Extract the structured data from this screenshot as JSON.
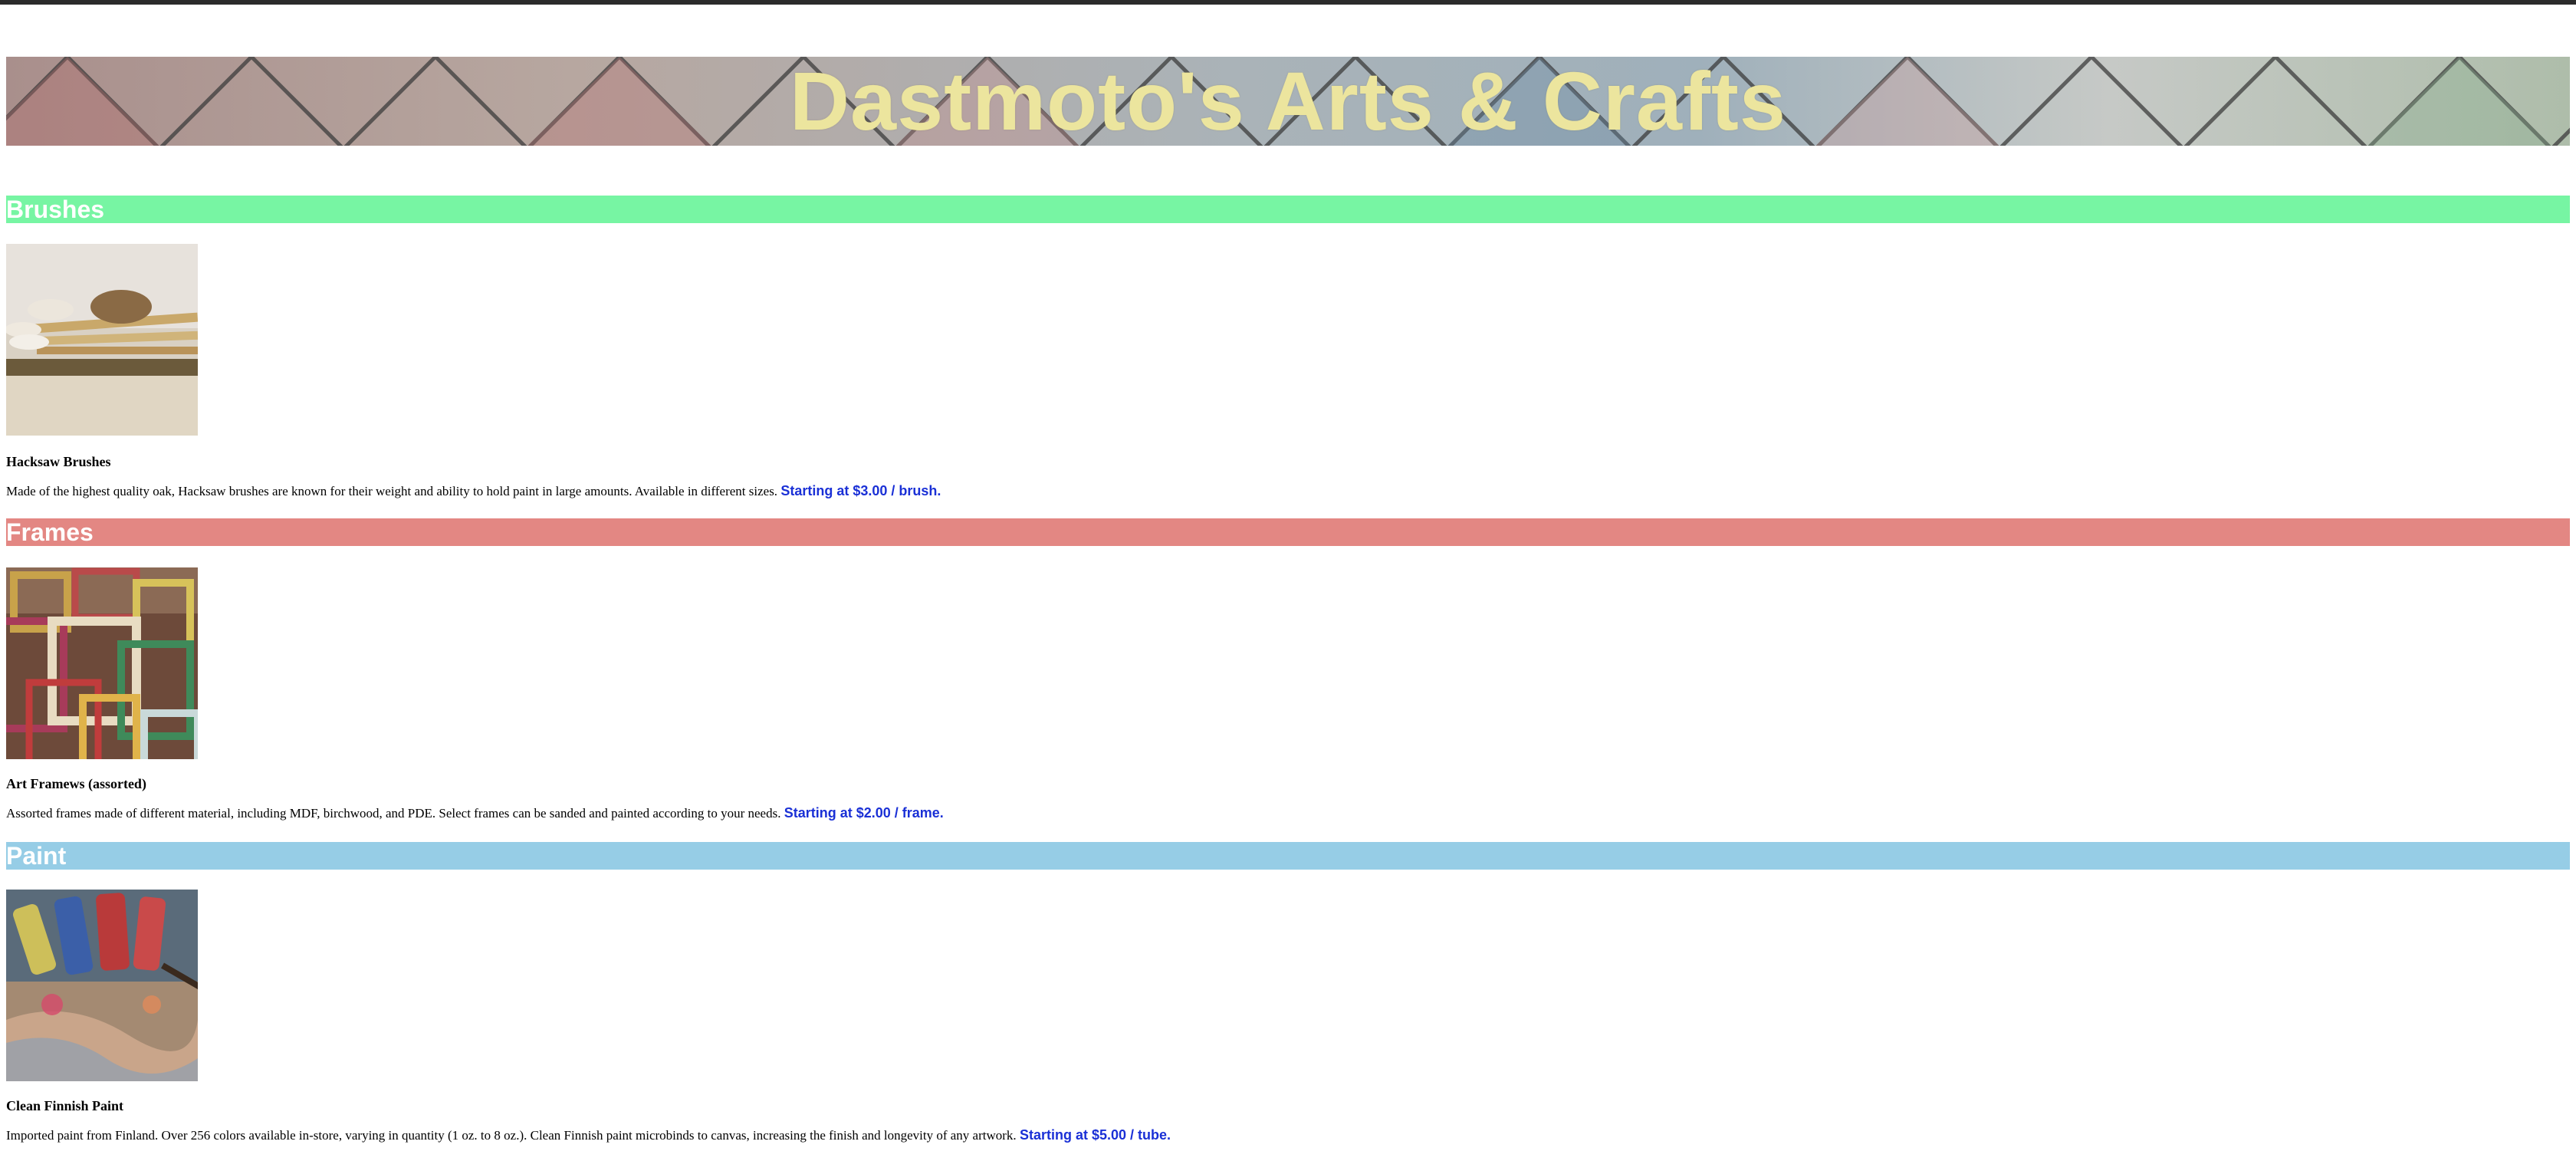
{
  "site_title": "Dastmoto's Arts & Crafts",
  "colors": {
    "title": "#ece59e",
    "brushes_header": "#77f5a3",
    "frames_header": "#e38783",
    "paint_header": "#96cde6",
    "price": "#1a30d6"
  },
  "sections": [
    {
      "heading": "Brushes",
      "image_icon": "brushes-photo",
      "product_name": "Hacksaw Brushes",
      "description": "Made of the highest quality oak, Hacksaw brushes are known for their weight and ability to hold paint in large amounts. Available in different sizes.",
      "price": "Starting at $3.00 / brush."
    },
    {
      "heading": "Frames",
      "image_icon": "frames-photo",
      "product_name": "Art Framews (assorted)",
      "description": "Assorted frames made of different material, including MDF, birchwood, and PDE. Select frames can be sanded and painted according to your needs.",
      "price": "Starting at $2.00 / frame."
    },
    {
      "heading": "Paint",
      "image_icon": "paint-photo",
      "product_name": "Clean Finnish Paint",
      "description": "Imported paint from Finland. Over 256 colors available in-store, varying in quantity (1 oz. to 8 oz.). Clean Finnish paint microbinds to canvas, increasing the finish and longevity of any artwork.",
      "price": "Starting at $5.00 / tube."
    }
  ]
}
